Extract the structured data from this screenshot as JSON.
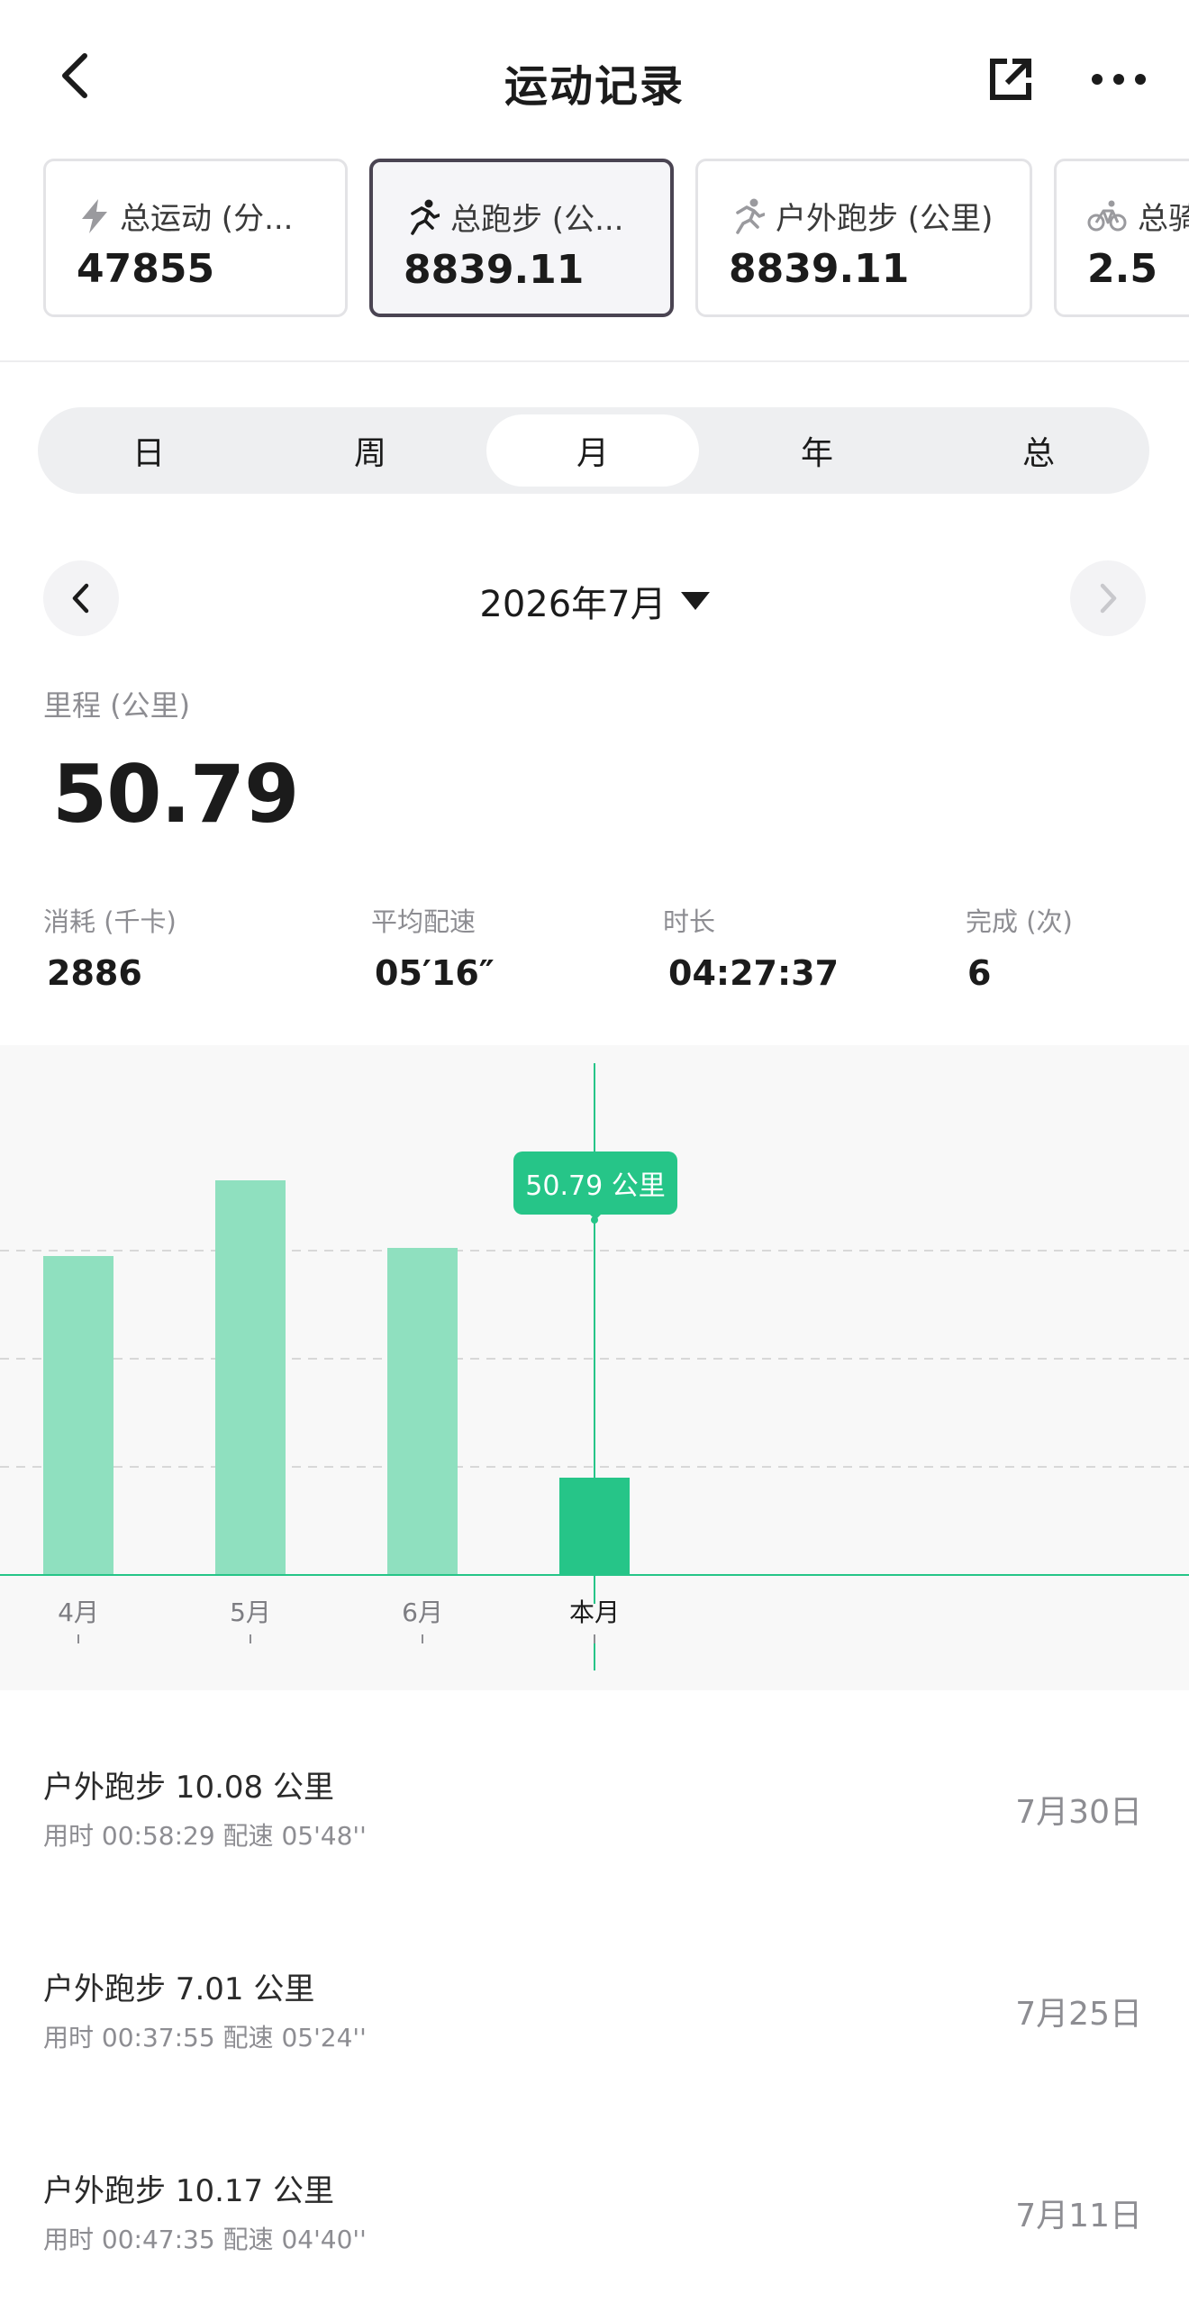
{
  "header": {
    "title": "运动记录",
    "back_icon": "chevron-left-icon",
    "share_icon": "share-external-icon",
    "more_icon": "more-dots-icon"
  },
  "cards": [
    {
      "label": "总运动 (分...",
      "value": "47855",
      "icon": "lightning-icon",
      "active": false
    },
    {
      "label": "总跑步 (公...",
      "value": "8839.11",
      "icon": "runner-icon",
      "active": true
    },
    {
      "label": "户外跑步 (公里)",
      "value": "8839.11",
      "icon": "runner-icon",
      "active": false
    },
    {
      "label": "总骑",
      "value": "2.5",
      "icon": "bicycle-icon",
      "active": false
    }
  ],
  "segments": {
    "items": [
      "日",
      "周",
      "月",
      "年",
      "总"
    ],
    "selected": "月"
  },
  "date_nav": {
    "label": "2026年7月"
  },
  "metric": {
    "label": "里程 (公里)",
    "value": "50.79"
  },
  "stats": [
    {
      "label": "消耗 (千卡)",
      "value": "2886"
    },
    {
      "label": "平均配速",
      "value": "05′16″"
    },
    {
      "label": "时长",
      "value": "04:27:37"
    },
    {
      "label": "完成 (次)",
      "value": "6"
    }
  ],
  "chart_data": {
    "type": "bar",
    "categories": [
      "4月",
      "5月",
      "6月",
      "本月"
    ],
    "values": [
      118,
      146,
      121,
      36
    ],
    "ylim": [
      0,
      160
    ],
    "selected_index": 3,
    "tooltip": "50.79 公里",
    "grid": true,
    "colors": {
      "bar": "#8fe0bf",
      "bar_selected": "#26c588",
      "axis": "#26c588",
      "grid": "#d8d8d8"
    }
  },
  "records": [
    {
      "title": "户外跑步  10.08 公里",
      "detail": "用时 00:58:29    配速 05'48''",
      "date": "7月30日"
    },
    {
      "title": "户外跑步  7.01 公里",
      "detail": "用时 00:37:55    配速 05'24''",
      "date": "7月25日"
    },
    {
      "title": "户外跑步  10.17 公里",
      "detail": "用时 00:47:35    配速 04'40''",
      "date": "7月11日"
    }
  ]
}
